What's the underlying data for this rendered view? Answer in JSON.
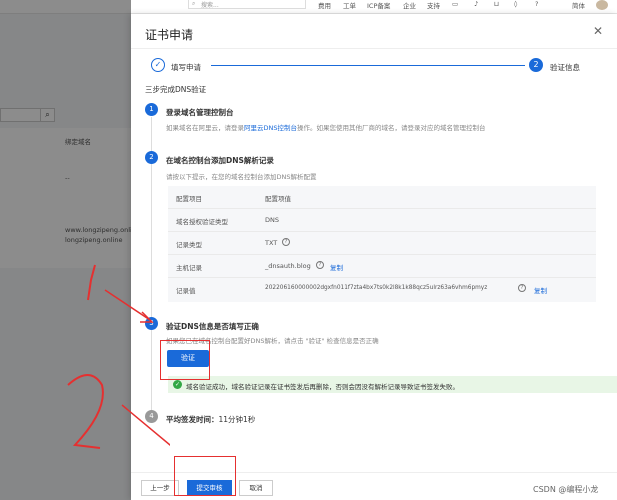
{
  "topbar": {
    "search_placeholder": "搜索...",
    "nav": [
      "费用",
      "工单",
      "ICP备案",
      "企业",
      "支持"
    ],
    "lang": "简体"
  },
  "background_table": {
    "header": "绑定域名",
    "rows": [
      "--",
      "www.longzipeng.online",
      "longzipeng.online"
    ]
  },
  "drawer": {
    "title": "证书申请",
    "steps": [
      {
        "num": "✓",
        "label": "填写申请"
      },
      {
        "num": "2",
        "label": "验证信息"
      }
    ],
    "intro": "三步完成DNS验证",
    "section1": {
      "num": "1",
      "title": "登录域名管理控制台",
      "desc_prefix": "如果域名在阿里云，请登录",
      "desc_link": "阿里云DNS控制台",
      "desc_suffix": "操作。如果您使用其他厂商的域名，请登录对应的域名管理控制台"
    },
    "section2": {
      "num": "2",
      "title": "在域名控制台添加DNS解析记录",
      "desc": "请按以下提示，在您的域名控制台添加DNS解析配置",
      "table_header": [
        "配置项目",
        "配置项值"
      ],
      "rows": [
        {
          "k": "域名授权验证类型",
          "v": "DNS"
        },
        {
          "k": "记录类型",
          "v": "TXT"
        },
        {
          "k": "主机记录",
          "v": "_dnsauth.blog",
          "copy": "复制"
        },
        {
          "k": "记录值",
          "v": "202206160000002dgxfn011f7zta4bx7ts0k2l8k1k88qcz5ulrz63a6vhm6pmyz",
          "copy": "复制"
        }
      ]
    },
    "section3": {
      "num": "3",
      "title": "验证DNS信息是否填写正确",
      "desc": "如果您已在域名控制台配置好DNS解析，请点击 \"验证\" 检查信息是否正确",
      "verify_label": "验证",
      "success": "域名验证成功，域名验证记录在证书签发后再删除，否则会因没有解析记录导致证书签发失败。"
    },
    "section4": {
      "num": "4",
      "label": "平均签发时间：",
      "value": "11分钟1秒"
    },
    "footer": {
      "prev": "上一步",
      "submit": "提交审核",
      "cancel": "取消"
    }
  },
  "watermark": "CSDN @编程小龙",
  "annotations": [
    "1",
    "2"
  ]
}
